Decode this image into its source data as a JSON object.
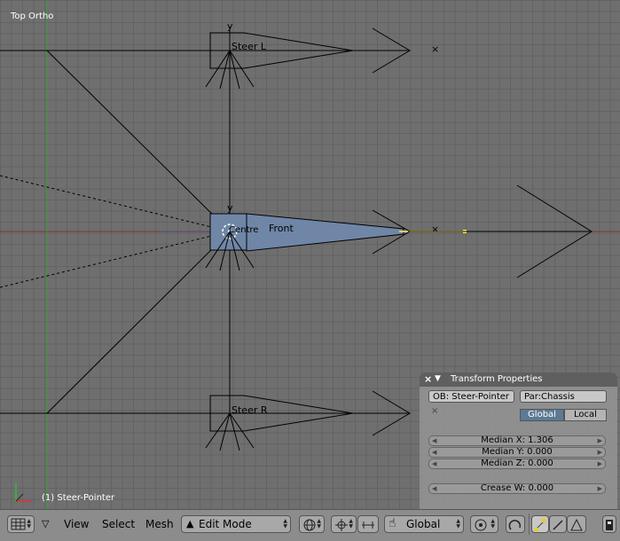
{
  "viewport": {
    "view_name": "Top Ortho",
    "active_object": "(1) Steer-Pointer",
    "labels": {
      "y_top": "y",
      "steer_l": "Steer L",
      "y_mid": "y",
      "center_overlap": "Centre",
      "steer_front": "Front",
      "steer_r": "Steer R",
      "x_marker_top": "×",
      "x_marker_mid": "×"
    }
  },
  "transform_panel": {
    "title": "Transform Properties",
    "object_name": "OB: Steer-Pointer",
    "parent": "Par:Chassis",
    "global_label": "Global",
    "local_label": "Local",
    "median_x": "Median X: 1.306",
    "median_y": "Median Y: 0.000",
    "median_z": "Median Z: 0.000",
    "crease_w": "Crease W: 0.000"
  },
  "header": {
    "menus": {
      "view": "View",
      "select": "Select",
      "mesh": "Mesh"
    },
    "mode": "Edit Mode",
    "orientation": "Global"
  },
  "colors": {
    "viewport_bg": "#6f6f6f",
    "x_axis": "#8b2f2f",
    "y_axis": "#3a9a3a",
    "selected_face": "#6f86a6",
    "selected_edge": "#f2c86e",
    "panel_toggle_active": "#5c7a95"
  },
  "icons": [
    "editor-grid-icon",
    "dropdown-arrow-icon",
    "mode-triangle-icon",
    "viewport-shading-icon",
    "pivot-icon",
    "manipulator-icon",
    "hand-grab-icon",
    "proportional-edit-icon",
    "snap-icon",
    "vertex-select-icon",
    "edge-select-icon",
    "face-select-icon",
    "render-icon"
  ]
}
